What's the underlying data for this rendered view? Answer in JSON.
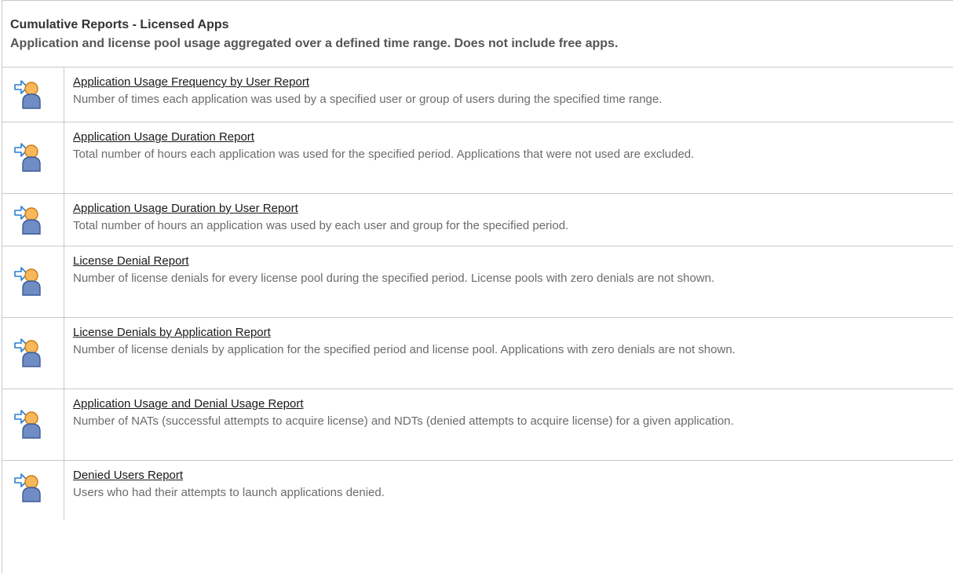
{
  "header": {
    "title": "Cumulative Reports - Licensed Apps",
    "subtitle": "Application and license pool usage aggregated over a defined time range. Does not include free apps."
  },
  "reports": [
    {
      "name": "Application Usage Frequency by User Report",
      "description": "Number of times each application was used by a specified user or group of users during the specified time range.",
      "icon": "user-arrow-icon"
    },
    {
      "name": "Application Usage Duration Report",
      "description": "Total number of hours each application was used for the specified period. Applications that were not used are excluded.",
      "icon": "user-arrow-icon"
    },
    {
      "name": "Application Usage Duration by User Report",
      "description": "Total number of hours an application was used by each user and group for the specified period.",
      "icon": "user-arrow-icon"
    },
    {
      "name": "License Denial Report",
      "description": "Number of license denials for every license pool during the specified period. License pools with zero denials are not shown.",
      "icon": "user-arrow-icon"
    },
    {
      "name": "License Denials by Application Report",
      "description": "Number of license denials by application for the specified period and license pool. Applications with zero denials are not shown.",
      "icon": "user-arrow-icon"
    },
    {
      "name": "Application Usage and Denial Usage Report",
      "description": "Number of NATs (successful attempts to acquire license) and NDTs (denied attempts to acquire license) for a given application.",
      "icon": "user-arrow-icon"
    },
    {
      "name": "Denied Users Report",
      "description": "Users who had their attempts to launch applications denied.",
      "icon": "user-arrow-icon"
    }
  ]
}
